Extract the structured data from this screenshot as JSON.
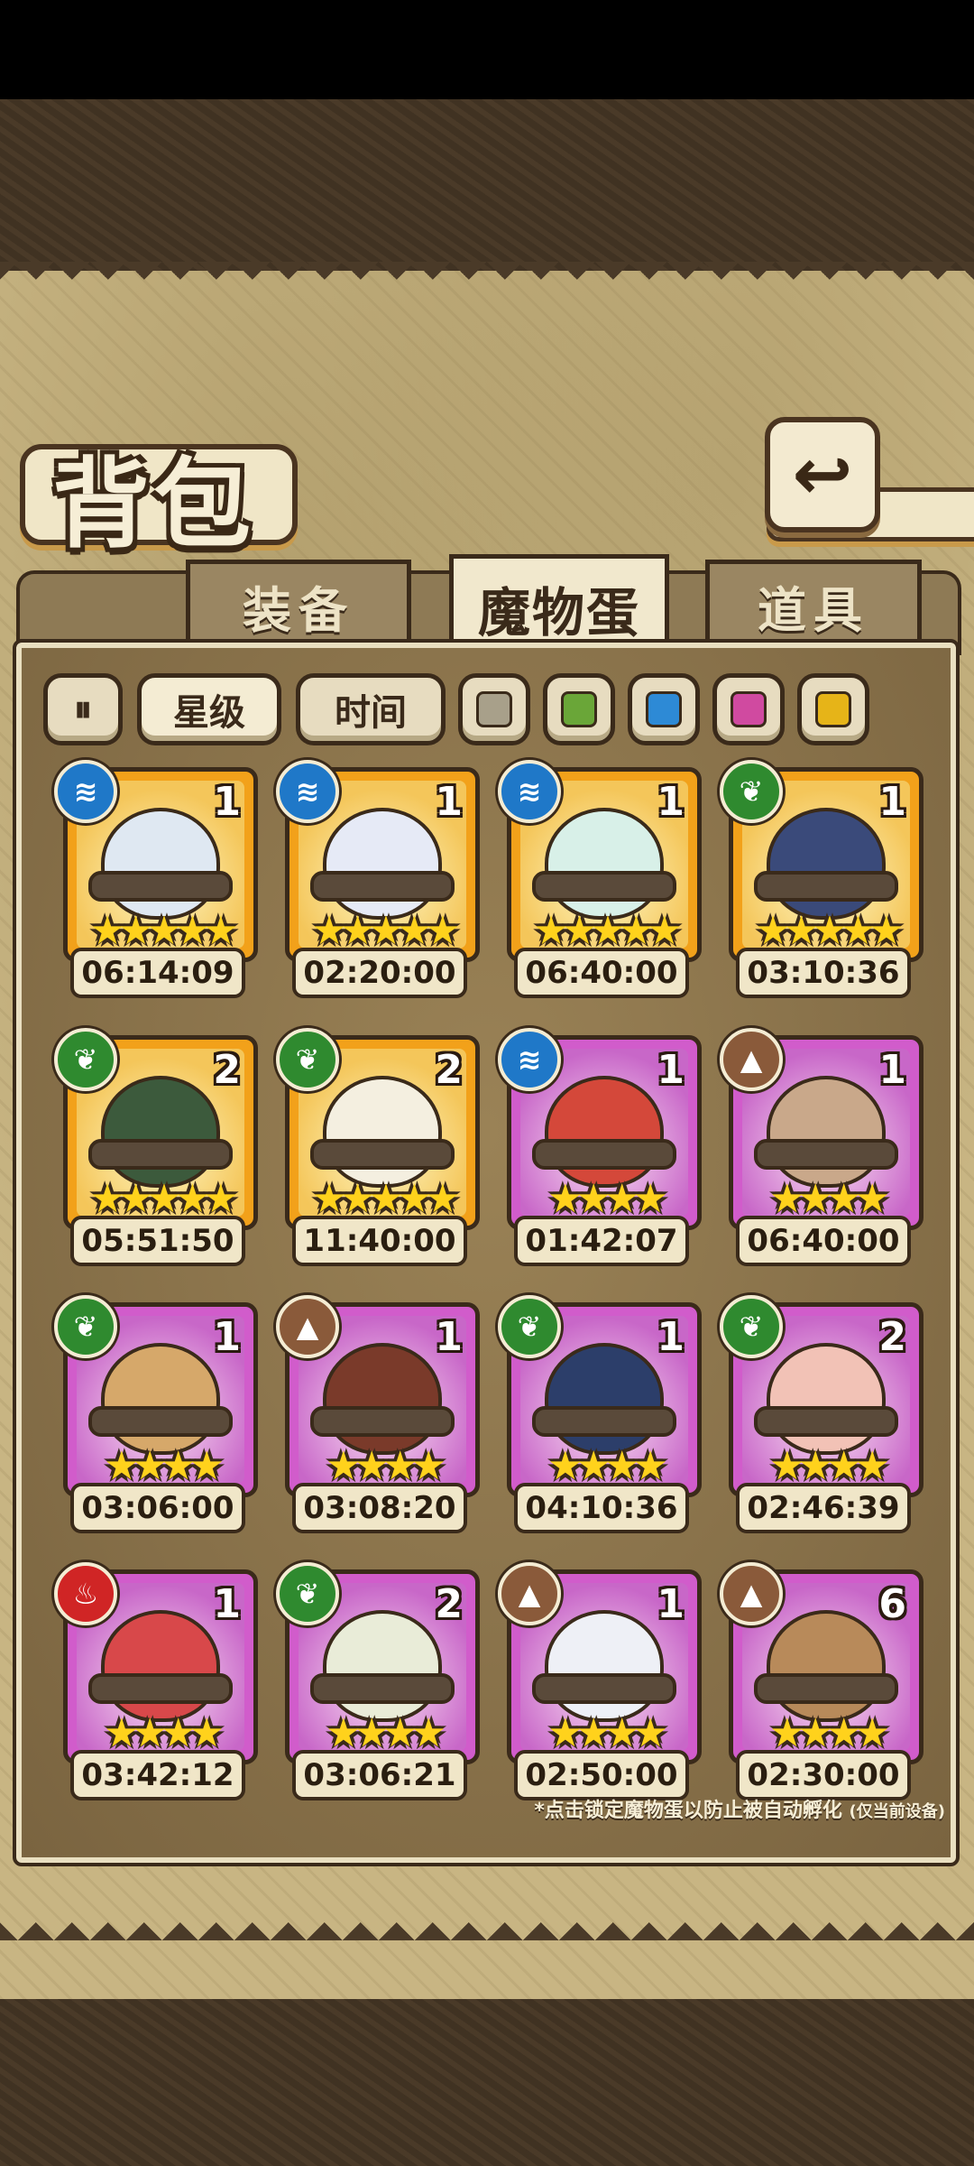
{
  "header": {
    "title": "背包",
    "back_icon": "↩"
  },
  "tabs": [
    {
      "label": "装备",
      "active": false
    },
    {
      "label": "魔物蛋",
      "active": true
    },
    {
      "label": "道具",
      "active": false
    }
  ],
  "filters": {
    "toggle_icon": "⏸",
    "sort_star": "星级",
    "sort_time": "时间",
    "colors": [
      "#a8a08a",
      "#6aa638",
      "#2d8ad6",
      "#d04aa0",
      "#e6b418"
    ]
  },
  "eggs": [
    {
      "count": "1",
      "stars": "★★★★★",
      "timer": "06:14:09",
      "element": "water",
      "rarity": "gold",
      "color": "#dfe8f2"
    },
    {
      "count": "1",
      "stars": "★★★★★",
      "timer": "02:20:00",
      "element": "water",
      "rarity": "gold",
      "color": "#e6eaf6"
    },
    {
      "count": "1",
      "stars": "★★★★★",
      "timer": "06:40:00",
      "element": "water",
      "rarity": "gold",
      "color": "#d8f0e8"
    },
    {
      "count": "1",
      "stars": "★★★★★",
      "timer": "03:10:36",
      "element": "nature",
      "rarity": "gold",
      "color": "#3a4a7a"
    },
    {
      "count": "2",
      "stars": "★★★★★",
      "timer": "05:51:50",
      "element": "nature",
      "rarity": "gold",
      "color": "#3c5a3c"
    },
    {
      "count": "2",
      "stars": "★★★★★",
      "timer": "11:40:00",
      "element": "nature",
      "rarity": "gold",
      "color": "#f4efe0"
    },
    {
      "count": "1",
      "stars": "★★★★",
      "timer": "01:42:07",
      "element": "water",
      "rarity": "purple",
      "color": "#d4483a"
    },
    {
      "count": "1",
      "stars": "★★★★",
      "timer": "06:40:00",
      "element": "earth",
      "rarity": "purple",
      "color": "#c9a88a"
    },
    {
      "count": "1",
      "stars": "★★★★",
      "timer": "03:06:00",
      "element": "nature",
      "rarity": "purple",
      "color": "#d6a86a"
    },
    {
      "count": "1",
      "stars": "★★★★",
      "timer": "03:08:20",
      "element": "earth",
      "rarity": "purple",
      "color": "#7a3a2a"
    },
    {
      "count": "1",
      "stars": "★★★★",
      "timer": "04:10:36",
      "element": "nature",
      "rarity": "purple",
      "color": "#2c3e6a"
    },
    {
      "count": "2",
      "stars": "★★★★",
      "timer": "02:46:39",
      "element": "nature",
      "rarity": "purple",
      "color": "#f2c2b6"
    },
    {
      "count": "1",
      "stars": "★★★★",
      "timer": "03:42:12",
      "element": "fire",
      "rarity": "purple",
      "color": "#d8484a"
    },
    {
      "count": "2",
      "stars": "★★★★",
      "timer": "03:06:21",
      "element": "nature",
      "rarity": "purple",
      "color": "#e9ecd8"
    },
    {
      "count": "1",
      "stars": "★★★★",
      "timer": "02:50:00",
      "element": "earth",
      "rarity": "purple",
      "color": "#eef0f6"
    },
    {
      "count": "6",
      "stars": "★★★★",
      "timer": "02:30:00",
      "element": "earth",
      "rarity": "purple",
      "color": "#b88a5a"
    }
  ],
  "element_icons": {
    "water": "≋",
    "nature": "❦",
    "earth": "▲",
    "fire": "♨"
  },
  "footnote": {
    "main": "*点击锁定魔物蛋以防止被自动孵化",
    "aside": "(仅当前设备)"
  }
}
